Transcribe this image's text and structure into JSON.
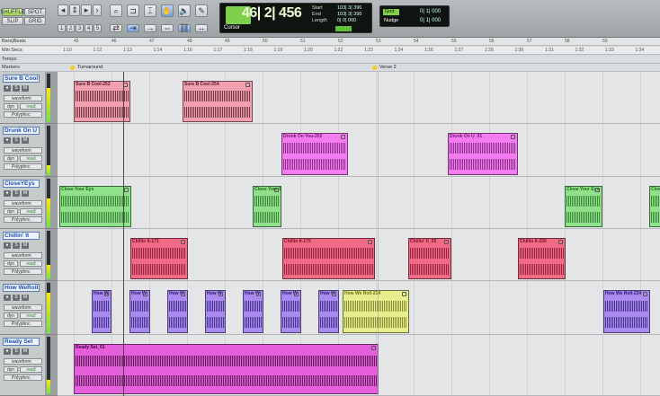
{
  "toolbar": {
    "edit_modes": [
      "SHUFFLE",
      "SPOT",
      "SLIP",
      "GRID"
    ],
    "zoom_presets": [
      "1",
      "2",
      "3",
      "4",
      "5"
    ],
    "counter_main": "46| 2| 456",
    "counter_mode": "Cursor",
    "start_label": "Start",
    "end_label": "End",
    "length_label": "Length",
    "start_value": "103| 3| 396",
    "end_value": "103| 3| 396",
    "length_value": "0| 0| 000",
    "grid_label": "Grid",
    "grid_value": "0| 1| 000",
    "nudge_label": "Nudge",
    "nudge_value": "0| 1| 000"
  },
  "rulers": {
    "rows": [
      "Bars|Beats",
      "Min:Secs",
      "Tempo",
      "Markers"
    ],
    "bars": [
      "45",
      "46",
      "47",
      "48",
      "49",
      "50",
      "51",
      "52",
      "53",
      "54",
      "55",
      "56",
      "57",
      "58",
      "59"
    ],
    "mins": [
      "1:10",
      "1:12",
      "1:13",
      "1:14",
      "1:16",
      "1:17",
      "1:18",
      "1:19",
      "1:20",
      "1:22",
      "1:23",
      "1:24",
      "1:26",
      "1:27",
      "1:28",
      "1:30",
      "1:31",
      "1:32",
      "1:33",
      "1:34"
    ],
    "markers": [
      "Turnaround",
      "Verse 2"
    ]
  },
  "track_labels": {
    "view": "waveform",
    "dyn": "dyn",
    "read": "read",
    "plugin": "Polyphnc"
  },
  "tracks": [
    {
      "name": "Sure B Cool",
      "clips": [
        "Sure B Cool-252",
        "Sure B Cool-254"
      ]
    },
    {
      "name": "Drunk On U",
      "clips": [
        "Drunk On You-202",
        "Drunk On U_01"
      ]
    },
    {
      "name": "CloseYEys",
      "clips": [
        "Close Your Eys",
        "Close Your Eye",
        "Close Your Eys",
        "Close"
      ]
    },
    {
      "name": "Chillin' It",
      "clips": [
        "Chillin It-171",
        "Chillin It-175",
        "Chillin' It_02",
        "Chillin It-226"
      ]
    },
    {
      "name": "How WeRoll",
      "clips": [
        "How W",
        "How W",
        "How W",
        "How W",
        "How W",
        "How W",
        "How W",
        "How We Roll-214",
        "How We Roll-224"
      ]
    },
    {
      "name": "Ready Set",
      "clips": [
        "Ready Set_01"
      ]
    }
  ],
  "colors": {
    "pink": "#f39fb0",
    "magenta": "#f47cf0",
    "green": "#8fe18a",
    "red": "#f26b86",
    "purple": "#a98af0",
    "yellow": "#e7ef8c",
    "ready": "#e45fd9"
  }
}
